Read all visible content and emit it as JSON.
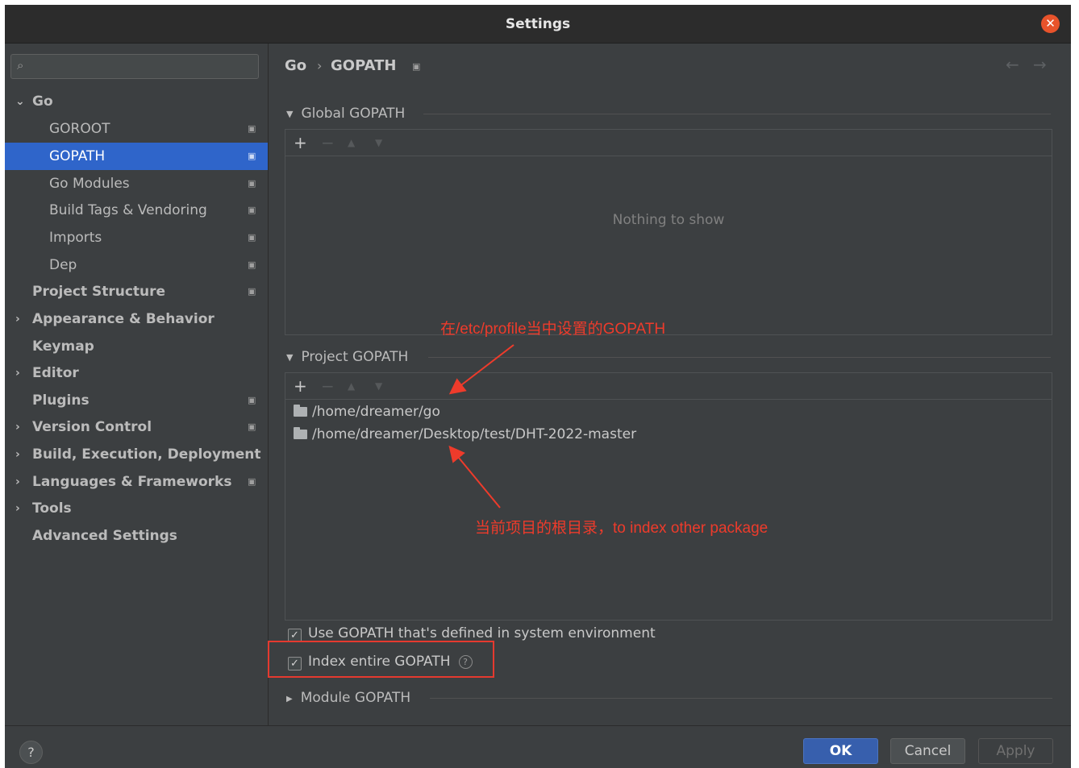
{
  "window": {
    "title": "Settings"
  },
  "sidebar": {
    "search": {
      "value": "",
      "placeholder": ""
    },
    "items": [
      {
        "label": "Go",
        "expanded": true
      },
      {
        "label": "GOROOT"
      },
      {
        "label": "GOPATH",
        "selected": true
      },
      {
        "label": "Go Modules"
      },
      {
        "label": "Build Tags & Vendoring"
      },
      {
        "label": "Imports"
      },
      {
        "label": "Dep"
      },
      {
        "label": "Project Structure"
      },
      {
        "label": "Appearance & Behavior"
      },
      {
        "label": "Keymap"
      },
      {
        "label": "Editor"
      },
      {
        "label": "Plugins"
      },
      {
        "label": "Version Control"
      },
      {
        "label": "Build, Execution, Deployment"
      },
      {
        "label": "Languages & Frameworks"
      },
      {
        "label": "Tools"
      },
      {
        "label": "Advanced Settings"
      }
    ]
  },
  "breadcrumb": {
    "parent": "Go",
    "separator": "›",
    "current": "GOPATH"
  },
  "global_gopath": {
    "title": "Global GOPATH",
    "toolbar": {
      "add": "+",
      "remove": "−",
      "up": "▲",
      "down": "▼"
    },
    "empty_text": "Nothing to show"
  },
  "project_gopath": {
    "title": "Project GOPATH",
    "toolbar": {
      "add": "+",
      "remove": "−",
      "up": "▲",
      "down": "▼"
    },
    "paths": [
      "/home/dreamer/go",
      "/home/dreamer/Desktop/test/DHT-2022-master"
    ]
  },
  "options": {
    "use_system_gopath": {
      "label": "Use GOPATH that's defined in system environment",
      "checked": true
    },
    "index_entire_gopath": {
      "label": "Index entire GOPATH",
      "checked": true
    }
  },
  "module_gopath": {
    "title": "Module GOPATH"
  },
  "annotations": {
    "top": "在/etc/profile当中设置的GOPATH",
    "bottom": "当前项目的根目录，to index other package"
  },
  "buttons": {
    "ok": "OK",
    "cancel": "Cancel",
    "apply": "Apply",
    "help": "?"
  },
  "colors": {
    "accent": "#2f65ca",
    "annotation": "#ee3b2b",
    "ok_button": "#375fad",
    "background": "#3c3f41"
  }
}
